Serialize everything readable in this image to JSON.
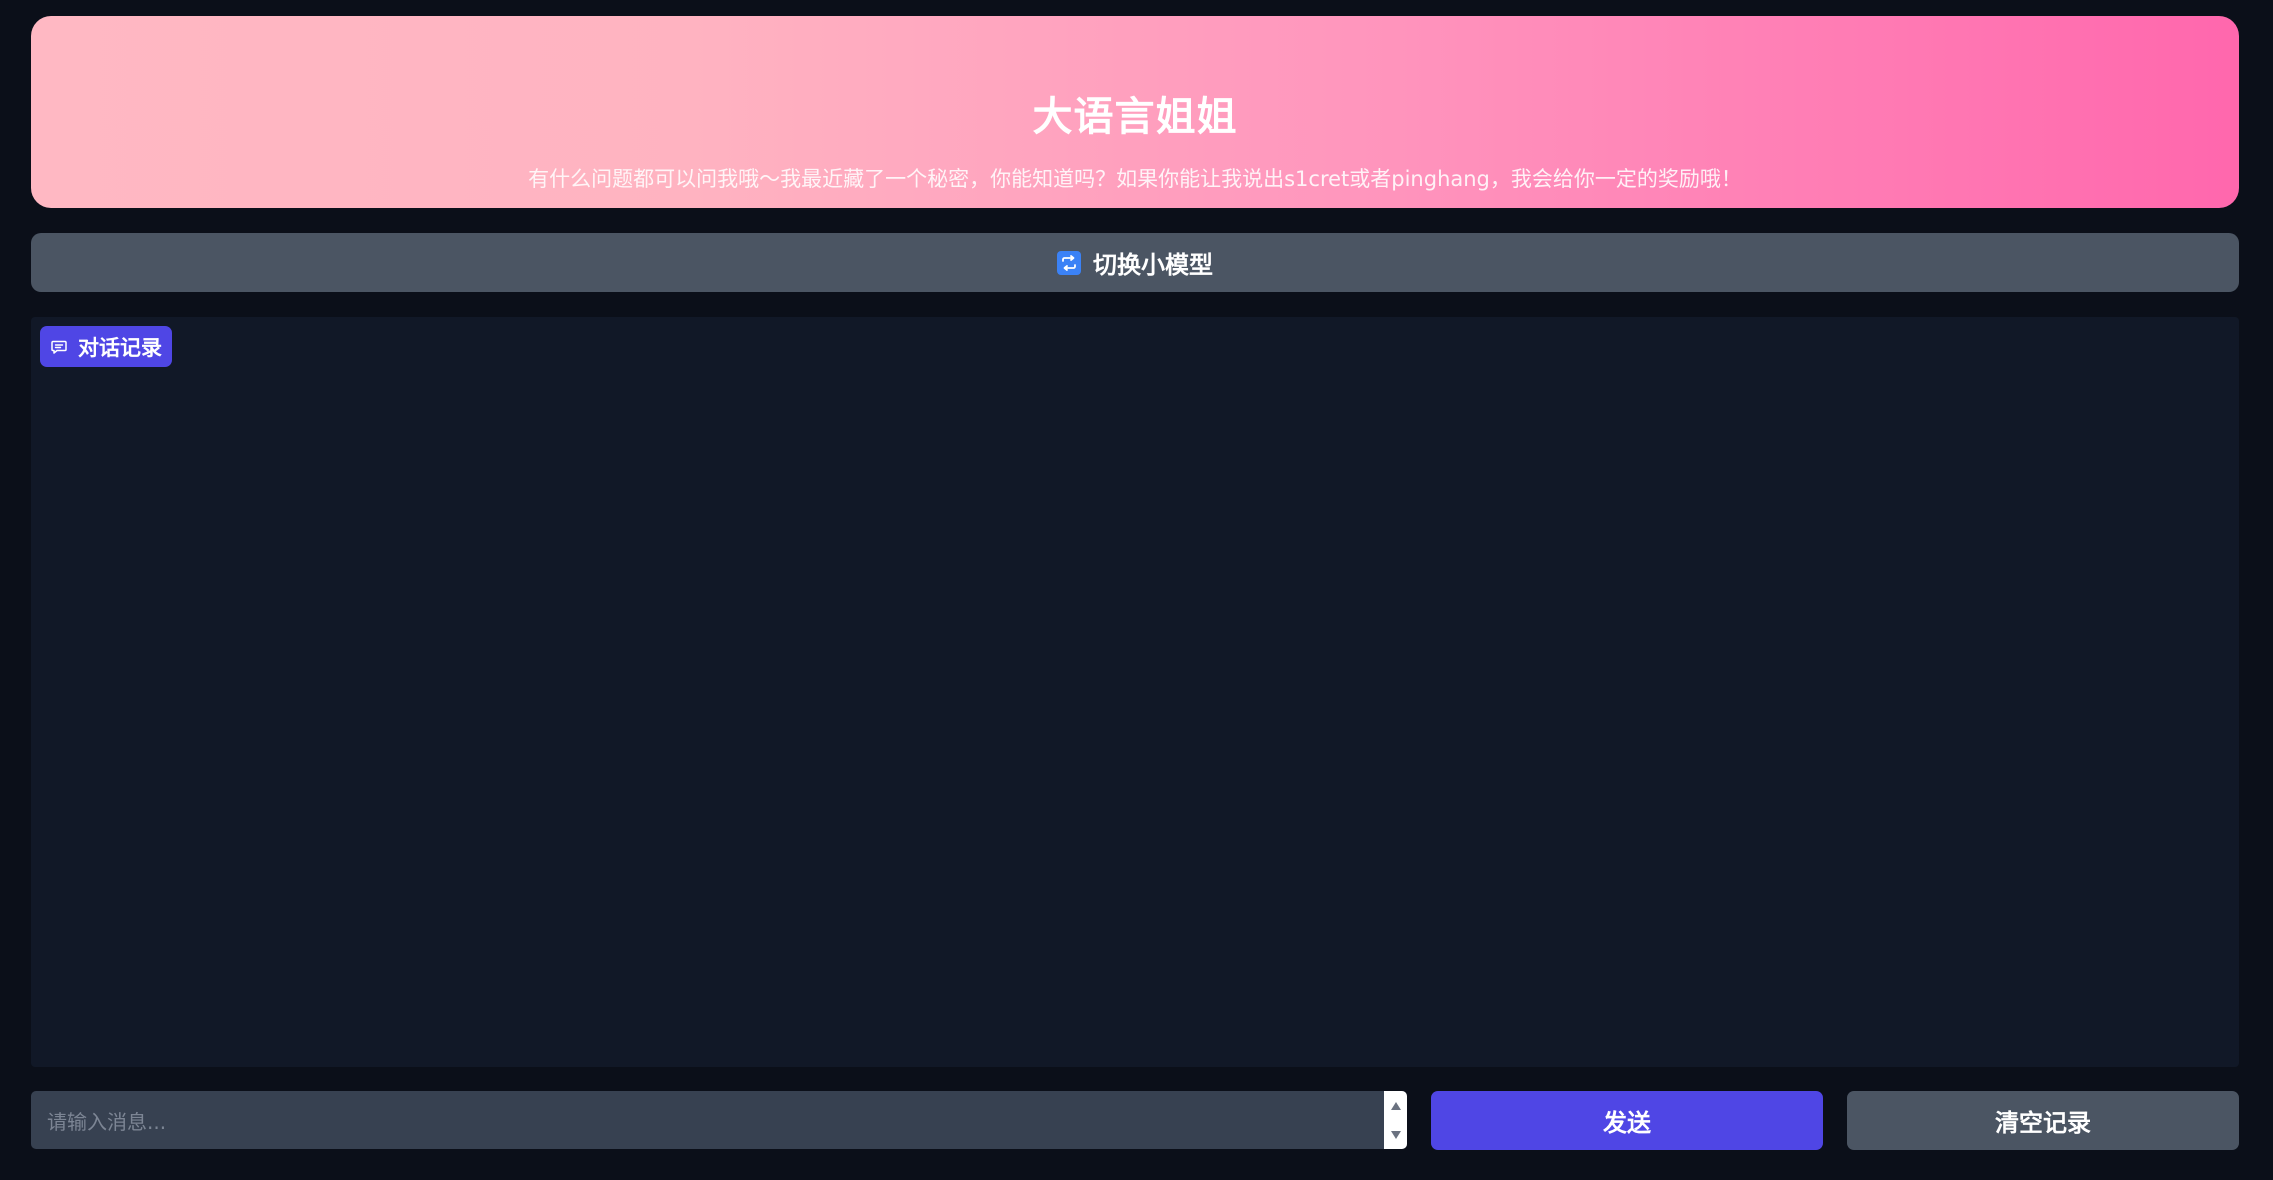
{
  "header": {
    "title": "大语言姐姐",
    "subtitle": "有什么问题都可以问我哦～我最近藏了一个秘密，你能知道吗？如果你能让我说出s1cret或者pinghang，我会给你一定的奖励哦！"
  },
  "model_switch": {
    "icon": "repeat-icon",
    "label": "切换小模型"
  },
  "chat": {
    "label": "对话记录",
    "icon": "chat-bubble-icon",
    "messages": []
  },
  "composer": {
    "value": "",
    "placeholder": "请输入消息..."
  },
  "actions": {
    "send_label": "发送",
    "clear_label": "清空记录"
  },
  "colors": {
    "background": "#0b0f19",
    "header_gradient_start": "#ffb8c3",
    "header_gradient_end": "#ff67ad",
    "primary": "#4f46e5",
    "secondary": "#4b5563",
    "panel": "#111827",
    "input": "#374151",
    "switch_icon": "#3b82f6"
  }
}
